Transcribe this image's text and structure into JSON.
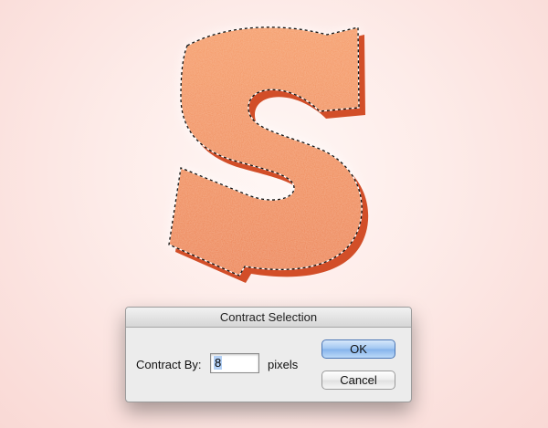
{
  "canvas": {
    "letter": "S",
    "letter_color": "#f08a55",
    "shadow_color": "#d2502a",
    "selection": "marching-ants"
  },
  "dialog": {
    "title": "Contract Selection",
    "field_label": "Contract By:",
    "field_value": "8",
    "unit": "pixels",
    "ok_label": "OK",
    "cancel_label": "Cancel"
  }
}
